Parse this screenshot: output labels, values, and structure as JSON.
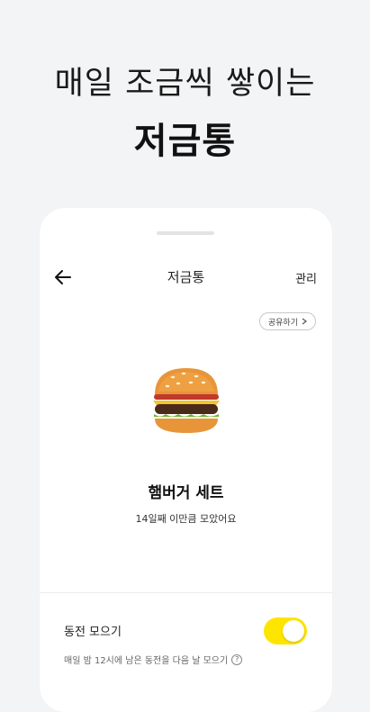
{
  "promo": {
    "line1": "매일 조금씩 쌓이는",
    "line2": "저금통"
  },
  "header": {
    "back_icon": "arrow-left-icon",
    "title": "저금통",
    "manage_label": "관리"
  },
  "share": {
    "label": "공유하기",
    "icon": "chevron-right-icon"
  },
  "goal": {
    "icon": "hamburger-icon",
    "name": "햄버거 세트",
    "progress_text": "14일째 이만큼 모았어요"
  },
  "coin_collect": {
    "label": "동전 모으기",
    "enabled": true,
    "toggle_color": "#fee500",
    "description": "매일 밤 12시에 남은 동전을 다음 날 모으기",
    "help_icon": "question-icon"
  }
}
